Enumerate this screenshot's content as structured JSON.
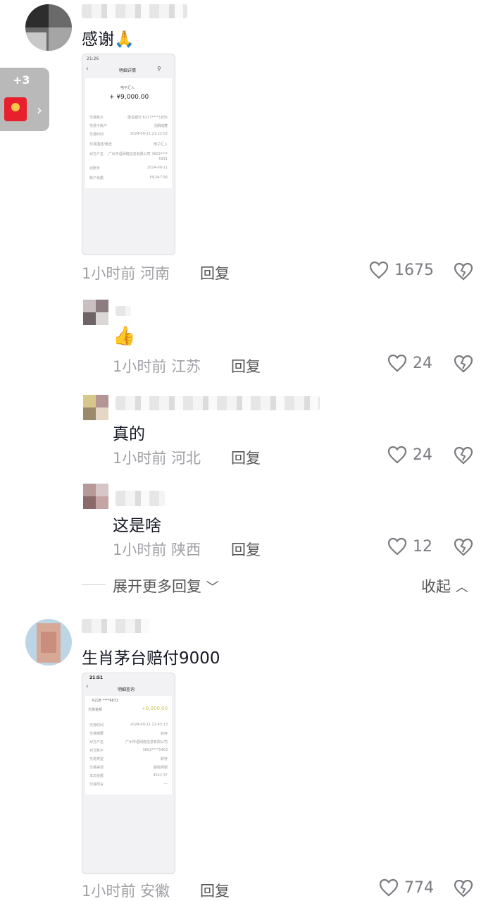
{
  "comments": [
    {
      "text": "感谢🙏",
      "time": "1小时前",
      "location": "河南",
      "reply": "回复",
      "likes": "1675"
    },
    {
      "text": "👍",
      "time": "1小时前",
      "location": "江苏",
      "reply": "回复",
      "likes": "24"
    },
    {
      "text": "真的",
      "time": "1小时前",
      "location": "河北",
      "reply": "回复",
      "likes": "24"
    },
    {
      "text": "这是啥",
      "time": "1小时前",
      "location": "陕西",
      "reply": "回复",
      "likes": "12"
    },
    {
      "text": "生肖茅台赔付9000",
      "time": "1小时前",
      "location": "安徽",
      "reply": "回复",
      "likes": "774"
    }
  ],
  "expand": {
    "more": "展开更多回复",
    "collapse": "收起"
  },
  "redpacket": {
    "badge": "+3"
  },
  "shot1": {
    "status_time": "21:26",
    "header": "明细详情",
    "type": "电子汇入",
    "amount": "+ ¥9,000.00",
    "rows": [
      {
        "k": "交易账户",
        "v": "建设银行 6217****1835"
      },
      {
        "k": "交易子账户",
        "v": "活期储蓄"
      },
      {
        "k": "交易时间",
        "v": "2024-09-11 21:22:02"
      },
      {
        "k": "交易描述/用途",
        "v": "电子汇入"
      },
      {
        "k": "对方户名",
        "v": "广州市语网络信息有限公司 3602****"
      },
      {
        "k": "",
        "v": "5931"
      },
      {
        "k": "记账日",
        "v": "2024-09-11"
      },
      {
        "k": "账户余额",
        "v": "¥9,047.56"
      }
    ]
  },
  "shot2": {
    "status_time": "21:51",
    "header": "明细查询",
    "account": "6228 ****6872",
    "label": "交易金额",
    "amount": "+9,000.00",
    "rows": [
      {
        "k": "交易时间",
        "v": "2024-09-11 21:43:13"
      },
      {
        "k": "交易摘要",
        "v": "转存"
      },
      {
        "k": "对方户名",
        "v": "广州市语网络信息有限公司"
      },
      {
        "k": "对方账户",
        "v": "3602****5403"
      },
      {
        "k": "交易类型",
        "v": "转存"
      },
      {
        "k": "交易渠道",
        "v": "超级网银"
      },
      {
        "k": "本次余额",
        "v": "4542.37"
      },
      {
        "k": "交易附言",
        "v": "---"
      }
    ]
  },
  "colors": {
    "text": "#161823",
    "meta": "#a0a0a5",
    "amount_green": "#c9c44a",
    "redpacket": "#e8202d"
  }
}
